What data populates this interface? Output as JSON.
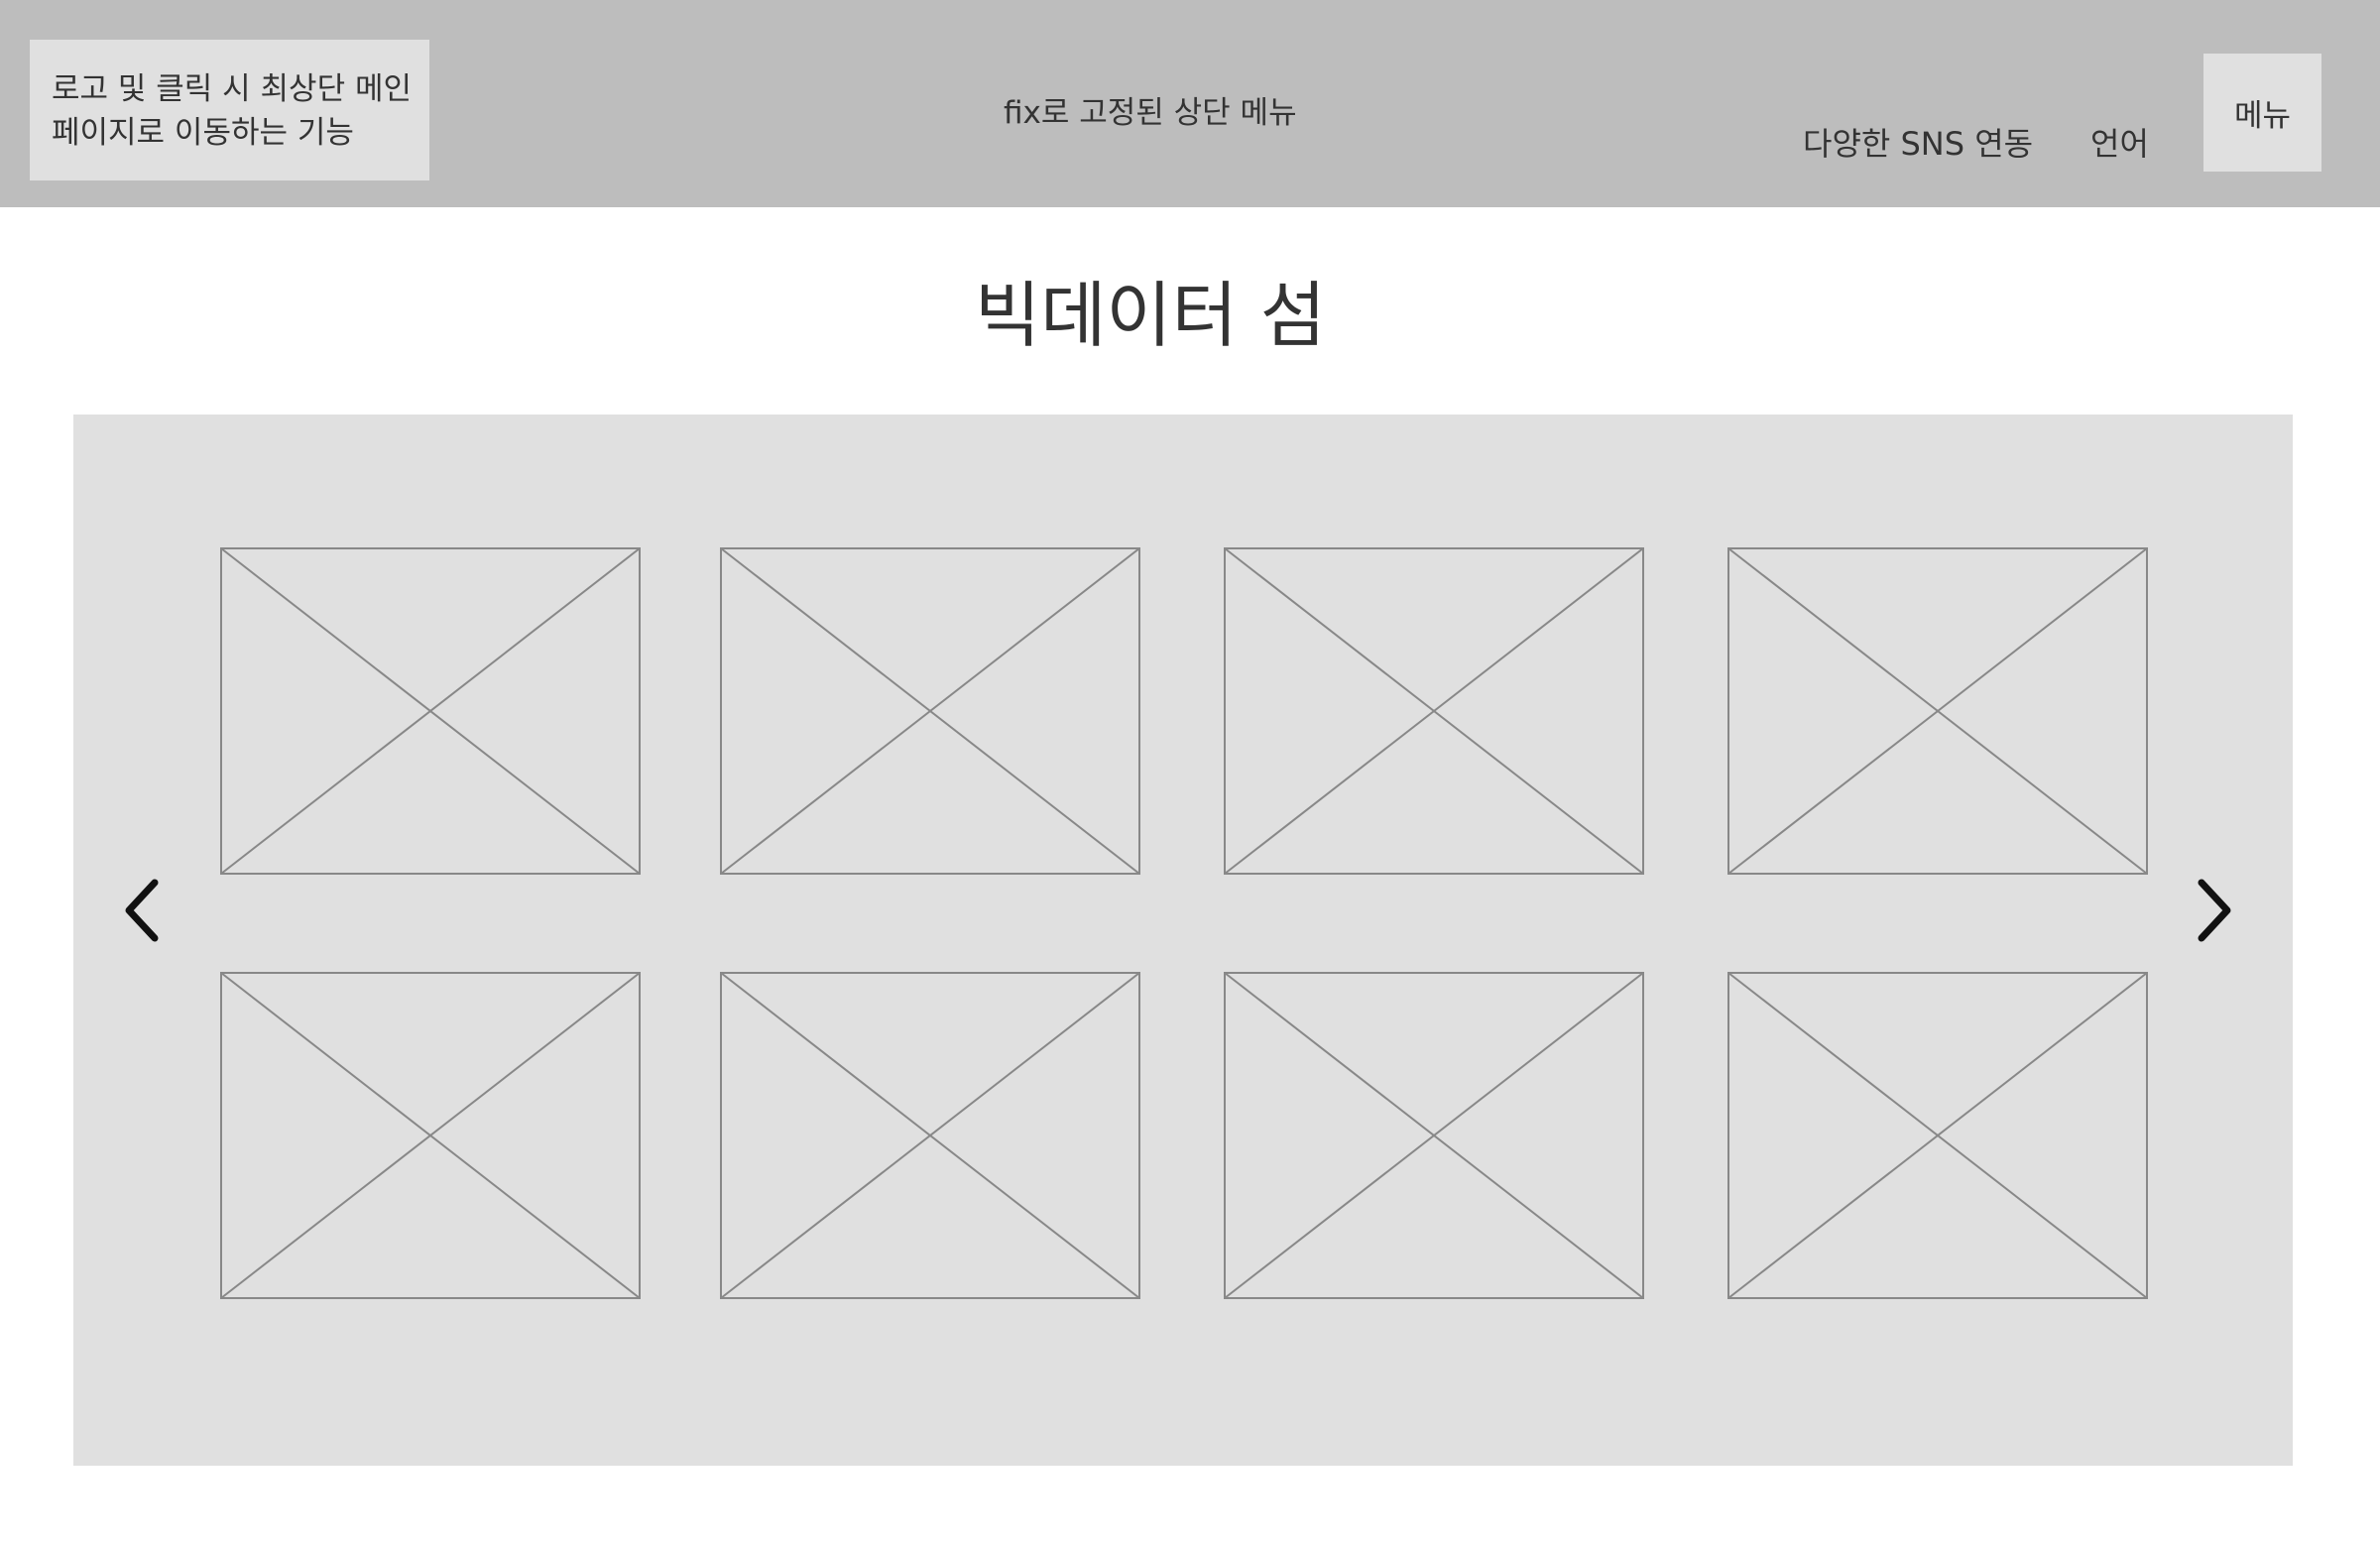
{
  "header": {
    "logo_line1": "로고 및 클릭 시 최상단 메인",
    "logo_line2": "페이지로 이동하는 기능",
    "center_text": "fix로 고정된 상단 메뉴",
    "sns_label": "다양한 SNS 연동",
    "language_label": "언어",
    "menu_label": "메뉴"
  },
  "main": {
    "title": "빅데이터 섬"
  },
  "carousel": {
    "prev_icon": "chevron-left-icon",
    "next_icon": "chevron-right-icon",
    "items": [
      {
        "type": "image-placeholder"
      },
      {
        "type": "image-placeholder"
      },
      {
        "type": "image-placeholder"
      },
      {
        "type": "image-placeholder"
      },
      {
        "type": "image-placeholder"
      },
      {
        "type": "image-placeholder"
      },
      {
        "type": "image-placeholder"
      },
      {
        "type": "image-placeholder"
      }
    ]
  },
  "colors": {
    "header_bg": "#bdbdbd",
    "panel_bg": "#e0e0e0",
    "placeholder_stroke": "#888888",
    "text": "#333333"
  }
}
